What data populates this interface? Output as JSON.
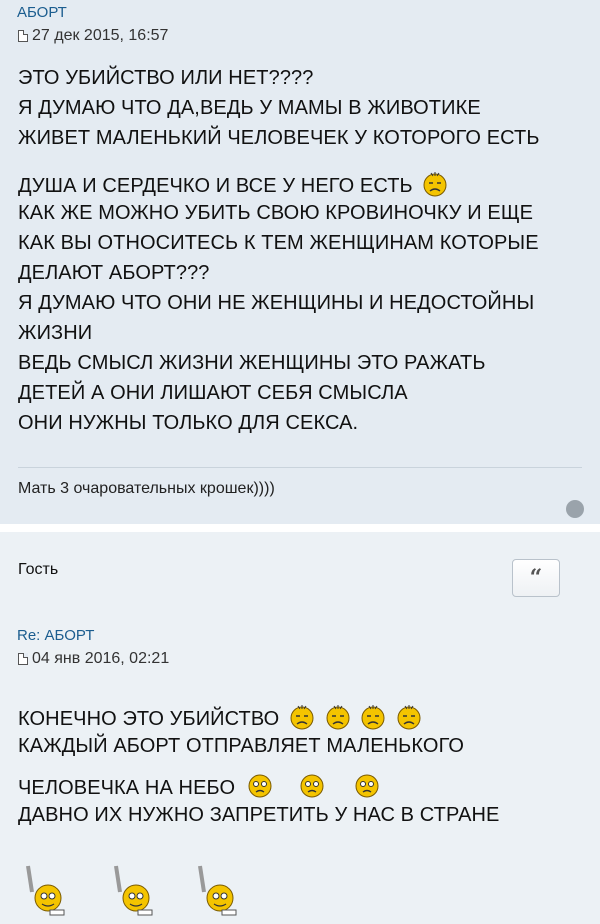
{
  "post1": {
    "title": "АБОРТ",
    "date": "27 дек 2015, 16:57",
    "lines": [
      "ЭТО УБИЙСТВО ИЛИ НЕТ????",
      "Я ДУМАЮ ЧТО ДА,ВЕДЬ У МАМЫ В ЖИВОТИКЕ",
      "ЖИВЕТ МАЛЕНЬКИЙ ЧЕЛОВЕЧЕК У КОТОРОГО ЕСТЬ",
      "ДУША И СЕРДЕЧКО И ВСЕ У НЕГО ЕСТЬ",
      "КАК ЖЕ МОЖНО УБИТЬ СВОЮ КРОВИНОЧКУ И ЕЩЕ",
      "КАК ВЫ ОТНОСИТЕСЬ К ТЕМ ЖЕНЩИНАМ КОТОРЫЕ",
      "ДЕЛАЮТ АБОРТ???",
      "Я ДУМАЮ ЧТО ОНИ НЕ ЖЕНЩИНЫ И НЕДОСТОЙНЫ",
      "ЖИЗНИ",
      "ВЕДЬ СМЫСЛ ЖИЗНИ ЖЕНЩИНЫ ЭТО РАЖАТЬ",
      "ДЕТЕЙ А ОНИ ЛИШАЮТ СЕБЯ СМЫСЛА",
      "ОНИ НУЖНЫ ТОЛЬКО ДЛЯ СЕКСА."
    ],
    "signature": "Мать 3 очаровательных крошек))))",
    "smiley_icon": "sad-smiley-icon"
  },
  "post2": {
    "author": "Гость",
    "quote_label": "“",
    "title": "Re: АБОРТ",
    "date": "04 янв 2016, 02:21",
    "lines": [
      "КОНЕЧНО ЭТО УБИЙСТВО",
      "КАЖДЫЙ АБОРТ ОТПРАВЛЯЕТ МАЛЕНЬКОГО",
      "ЧЕЛОВЕЧКА НА НЕБО",
      "ДАВНО ИХ НУЖНО ЗАПРЕТИТЬ У НАС В СТРАНЕ"
    ],
    "icons": [
      "sad-smiley-icon",
      "crying-smiley-icon",
      "waving-smiley-icon"
    ]
  },
  "colors": {
    "link": "#1b5d8f",
    "post_bg": "#e4ebf2",
    "smiley_yellow": "#f4c400"
  }
}
